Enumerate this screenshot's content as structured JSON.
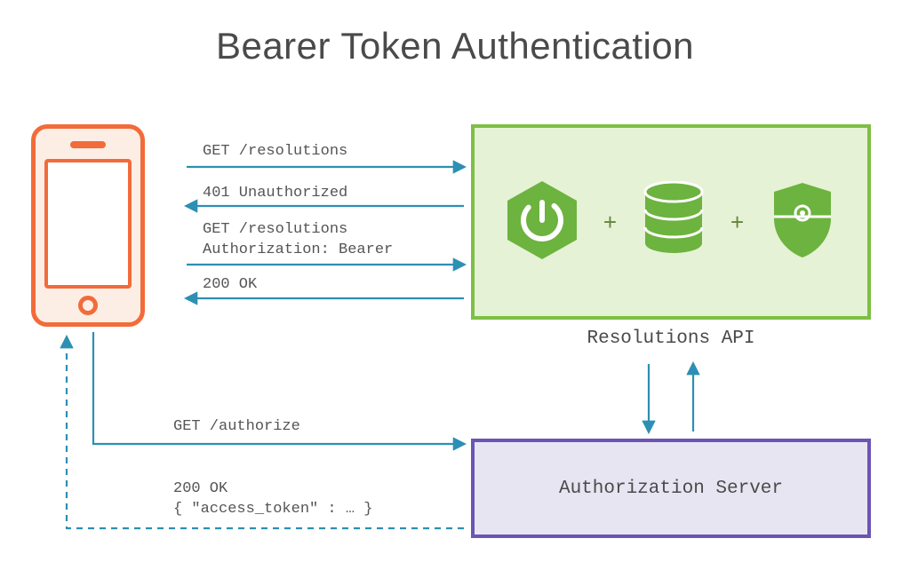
{
  "title": "Bearer Token Authentication",
  "flows": {
    "req1": "GET /resolutions",
    "resp1": "401 Unauthorized",
    "req2": "GET /resolutions\nAuthorization: Bearer",
    "resp2": "200 OK",
    "authreq": "GET /authorize",
    "authresp": "200 OK\n{ \"access_token\" : … }"
  },
  "api": {
    "label": "Resolutions API",
    "plus": "+"
  },
  "authserver": {
    "label": "Authorization Server"
  },
  "colors": {
    "phone": "#F26B3A",
    "api_border": "#7DBF44",
    "api_fill": "#E6F2D5",
    "auth_border": "#6B55B3",
    "auth_fill": "#E8E5F2",
    "arrow": "#2D8FB3",
    "icon_green": "#6DB33F"
  },
  "icons": {
    "spring": "power-icon",
    "database": "database-icon",
    "security": "shield-lock-icon"
  }
}
